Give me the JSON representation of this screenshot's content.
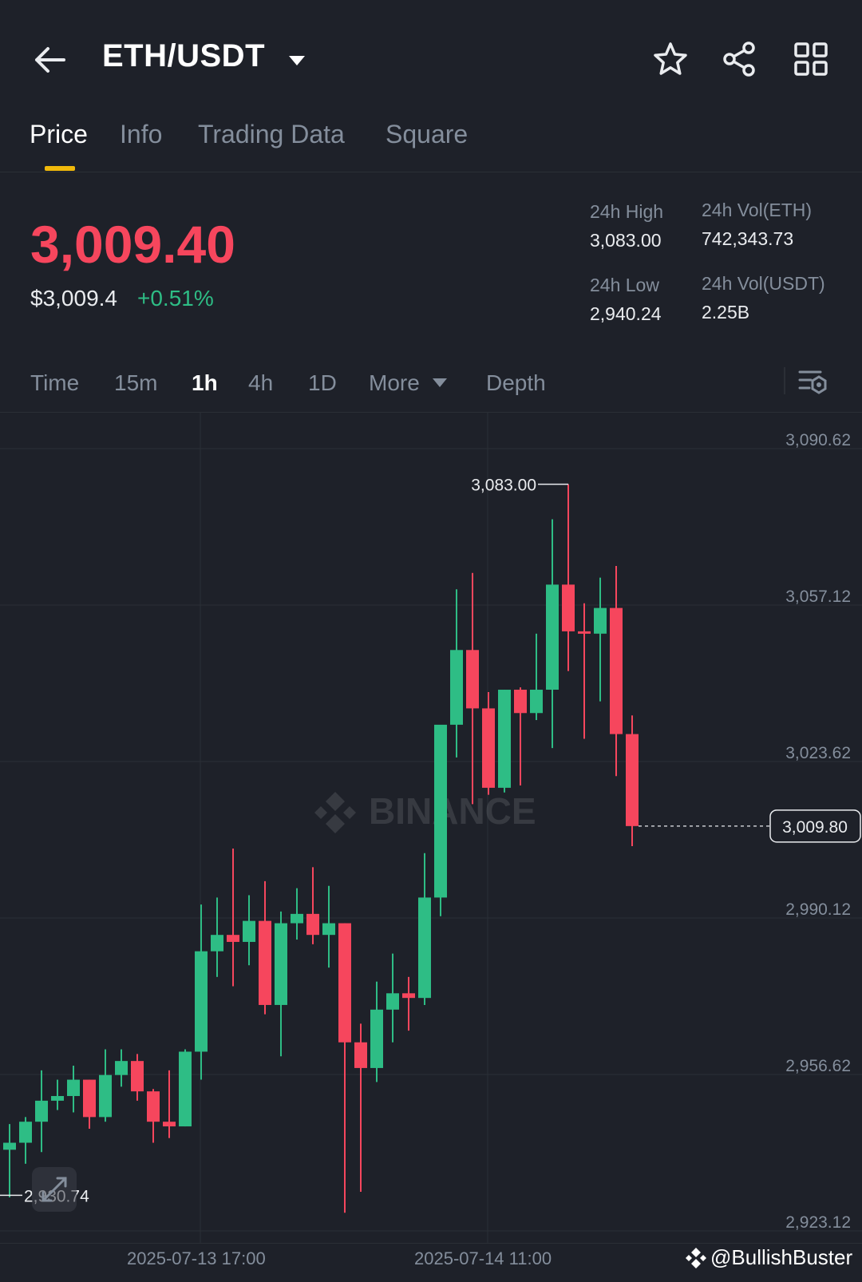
{
  "header": {
    "pair": "ETH/USDT"
  },
  "tabs": [
    "Price",
    "Info",
    "Trading Data",
    "Square"
  ],
  "ticker": {
    "last_price": "3,009.40",
    "usd_price": "$3,009.4",
    "change_pct": "+0.51%",
    "high_label": "24h High",
    "high_value": "3,083.00",
    "low_label": "24h Low",
    "low_value": "2,940.24",
    "vol_eth_label": "24h Vol(ETH)",
    "vol_eth_value": "742,343.73",
    "vol_usdt_label": "24h Vol(USDT)",
    "vol_usdt_value": "2.25B"
  },
  "intervals": [
    "Time",
    "15m",
    "1h",
    "4h",
    "1D",
    "More",
    "Depth"
  ],
  "active_interval": "1h",
  "colors": {
    "up": "#2ebd85",
    "down": "#f6465d",
    "accent": "#f0b90b",
    "bg": "#1e2129"
  },
  "watermark": {
    "logo_text": "BINANCE",
    "handle": "@BullishBuster"
  },
  "chart_data": {
    "type": "candlestick",
    "yticks": [
      "3,090.62",
      "3,057.12",
      "3,023.62",
      "2,990.12",
      "2,956.62",
      "2,923.12"
    ],
    "ylim": [
      2923.12,
      3098.3
    ],
    "xticks": [
      "2025-07-13 17:00",
      "2025-07-14 11:00"
    ],
    "annotations": {
      "max_label": "3,083.00",
      "min_label": "2,930.74",
      "current_price_label": "3,009.80"
    },
    "candles": [
      {
        "o": 2940.5,
        "h": 2946,
        "c": 2942.0,
        "l": 2930.3
      },
      {
        "o": 2942.0,
        "h": 2947.5,
        "c": 2946.5,
        "l": 2937.5
      },
      {
        "o": 2946.5,
        "h": 2957.5,
        "c": 2951.0,
        "l": 2940.0
      },
      {
        "o": 2951.0,
        "h": 2955.5,
        "c": 2952.0,
        "l": 2949.0
      },
      {
        "o": 2952.0,
        "h": 2958.5,
        "c": 2955.5,
        "l": 2948.5
      },
      {
        "o": 2955.5,
        "h": 2955.5,
        "c": 2947.5,
        "l": 2945.0
      },
      {
        "o": 2947.5,
        "h": 2962.0,
        "c": 2956.5,
        "l": 2946.5
      },
      {
        "o": 2956.5,
        "h": 2962.0,
        "c": 2959.5,
        "l": 2954.0
      },
      {
        "o": 2959.5,
        "h": 2961.0,
        "c": 2953.0,
        "l": 2951.0
      },
      {
        "o": 2953.0,
        "h": 2953.5,
        "c": 2946.5,
        "l": 2942.0
      },
      {
        "o": 2946.5,
        "h": 2957.5,
        "c": 2945.5,
        "l": 2943.0
      },
      {
        "o": 2945.5,
        "h": 2962.0,
        "c": 2961.5,
        "l": 2945.5
      },
      {
        "o": 2961.5,
        "h": 2993.0,
        "c": 2983.0,
        "l": 2955.5
      },
      {
        "o": 2983.0,
        "h": 2994.5,
        "c": 2986.5,
        "l": 2977.5
      },
      {
        "o": 2986.5,
        "h": 3005.0,
        "c": 2985.0,
        "l": 2975.5
      },
      {
        "o": 2985.0,
        "h": 2995.0,
        "c": 2989.5,
        "l": 2980.0
      },
      {
        "o": 2989.5,
        "h": 2998.0,
        "c": 2971.5,
        "l": 2969.5
      },
      {
        "o": 2971.5,
        "h": 2991.5,
        "c": 2989.0,
        "l": 2960.5
      },
      {
        "o": 2989.0,
        "h": 2996.5,
        "c": 2991.0,
        "l": 2985.5
      },
      {
        "o": 2991.0,
        "h": 3001.0,
        "c": 2986.5,
        "l": 2984.5
      },
      {
        "o": 2986.5,
        "h": 2997.0,
        "c": 2989.0,
        "l": 2979.5
      },
      {
        "o": 2989.0,
        "h": 2989.0,
        "c": 2963.5,
        "l": 2927.0
      },
      {
        "o": 2963.5,
        "h": 2967.5,
        "c": 2958.0,
        "l": 2931.5
      },
      {
        "o": 2958.0,
        "h": 2976.5,
        "c": 2970.5,
        "l": 2955.0
      },
      {
        "o": 2970.5,
        "h": 2982.5,
        "c": 2974.0,
        "l": 2963.5
      },
      {
        "o": 2974.0,
        "h": 2977.5,
        "c": 2973.0,
        "l": 2966.0
      },
      {
        "o": 2973.0,
        "h": 3004.0,
        "c": 2994.5,
        "l": 2971.5
      },
      {
        "o": 2994.5,
        "h": 3030.5,
        "c": 3031.5,
        "l": 2990.5
      },
      {
        "o": 3031.5,
        "h": 3060.5,
        "c": 3047.5,
        "l": 3024.5
      },
      {
        "o": 3047.5,
        "h": 3064.0,
        "c": 3035.0,
        "l": 3014.5
      },
      {
        "o": 3035.0,
        "h": 3038.5,
        "c": 3018.0,
        "l": 3016.5
      },
      {
        "o": 3018.0,
        "h": 3039.0,
        "c": 3039.0,
        "l": 3017.0
      },
      {
        "o": 3039.0,
        "h": 3039.5,
        "c": 3034.0,
        "l": 3018.5
      },
      {
        "o": 3034.0,
        "h": 3051.0,
        "c": 3039.0,
        "l": 3032.5
      },
      {
        "o": 3039.0,
        "h": 3075.5,
        "c": 3061.5,
        "l": 3026.5
      },
      {
        "o": 3061.5,
        "h": 3083.0,
        "c": 3051.5,
        "l": 3043.0
      },
      {
        "o": 3051.5,
        "h": 3057.5,
        "c": 3051.0,
        "l": 3028.5
      },
      {
        "o": 3051.0,
        "h": 3063.0,
        "c": 3056.5,
        "l": 3036.5
      },
      {
        "o": 3056.5,
        "h": 3065.5,
        "c": 3029.5,
        "l": 3020.5
      },
      {
        "o": 3029.5,
        "h": 3033.5,
        "c": 3009.8,
        "l": 3005.5
      }
    ]
  }
}
